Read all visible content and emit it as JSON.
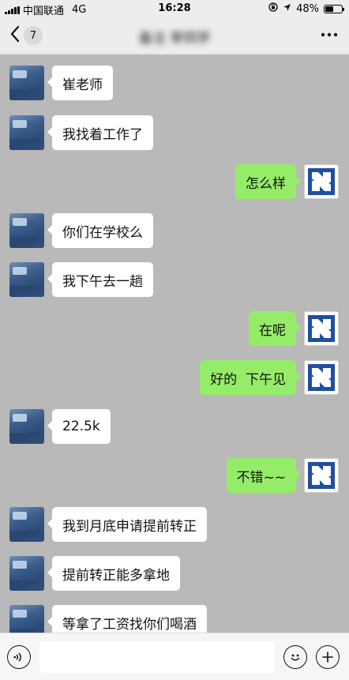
{
  "status_bar": {
    "carrier": "中国联通",
    "network": "4G",
    "time": "16:28",
    "battery": "48%",
    "battery_level": 0.48
  },
  "nav": {
    "back_count": "7",
    "title": "备注 李同学"
  },
  "messages": [
    {
      "side": "in",
      "text": "崔老师"
    },
    {
      "side": "in",
      "text": "我找着工作了"
    },
    {
      "side": "out",
      "text": "怎么样"
    },
    {
      "side": "in",
      "text": "你们在学校么"
    },
    {
      "side": "in",
      "text": "我下午去一趟"
    },
    {
      "side": "out",
      "text": "在呢"
    },
    {
      "side": "out",
      "text": "好的  下午见"
    },
    {
      "side": "in",
      "text": "22.5k"
    },
    {
      "side": "out",
      "text": "不错~~"
    },
    {
      "side": "in",
      "text": "我到月底申请提前转正"
    },
    {
      "side": "in",
      "text": "提前转正能多拿地"
    },
    {
      "side": "in",
      "text": "等拿了工资找你们喝酒"
    }
  ],
  "input": {
    "value": "",
    "placeholder": ""
  },
  "colors": {
    "chat_background": "#b9b9b9",
    "incoming_bubble": "#ffffff",
    "outgoing_bubble": "#95ec69",
    "outgoing_avatar_blue": "#1f4fa0"
  },
  "icons": {
    "back": "chevron-left-icon",
    "more": "more-dots-icon",
    "voice": "voice-icon",
    "emoji": "emoji-icon",
    "plus": "plus-icon"
  }
}
